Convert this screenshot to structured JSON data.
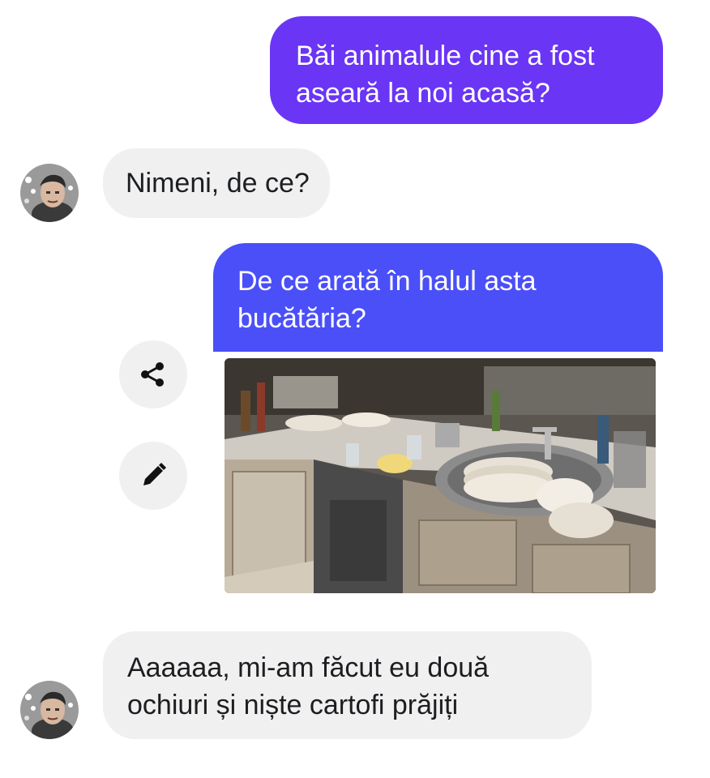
{
  "messages": {
    "m1": {
      "line1": "Băi animalule cine a fost",
      "line2": "aseară la noi acasă?"
    },
    "m2": {
      "line1": "Nimeni, de ce?"
    },
    "m3": {
      "line1": "De ce arată în halul asta",
      "line2": "bucătăria?"
    },
    "m4": {
      "line1": "Aaaaaa, mi-am făcut eu două",
      "line2": "ochiuri și niște cartofi prăjiți"
    }
  },
  "icons": {
    "share": "share-icon",
    "edit": "pencil-icon"
  },
  "colors": {
    "outgoing_purple": "#6a35f5",
    "outgoing_blue": "#4a4ff8",
    "incoming_gray": "#f0f0f0",
    "text_dark": "#1c1e21"
  }
}
